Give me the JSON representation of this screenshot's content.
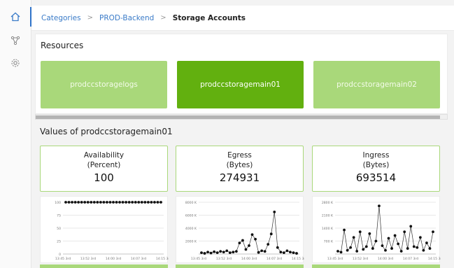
{
  "breadcrumb": {
    "items": [
      "Categories",
      "PROD-Backend"
    ],
    "current": "Storage Accounts"
  },
  "icons": {
    "home": "home-icon",
    "nodes": "network-nodes-icon",
    "settings": "gear-icon"
  },
  "colors": {
    "accent": "#2f73c9",
    "card_light": "#a9d87a",
    "card_active": "#62b00f"
  },
  "resources": {
    "title": "Resources",
    "cards": [
      "prodccstoragelogs",
      "prodccstoragemain01",
      "prodccstoragemain02"
    ],
    "selected": "prodccstoragemain01"
  },
  "values": {
    "title": "Values of prodccstoragemain01",
    "metrics": [
      {
        "name": "Availability",
        "unit": "(Percent)",
        "value": "100"
      },
      {
        "name": "Egress",
        "unit": "(Bytes)",
        "value": "274931"
      },
      {
        "name": "Ingress",
        "unit": "(Bytes)",
        "value": "693514"
      }
    ]
  },
  "chart_data": [
    {
      "type": "line",
      "x_tick_labels": [
        "13:45 3rd",
        "13:52 3rd",
        "14:00 3rd",
        "14:07 3rd",
        "14:15 3rd"
      ],
      "y_tick_labels": [
        "0",
        "25",
        "50",
        "75",
        "100"
      ],
      "ylim": [
        0,
        100
      ],
      "values": [
        100,
        100,
        100,
        100,
        100,
        100,
        100,
        100,
        100,
        100,
        100,
        100,
        100,
        100,
        100,
        100,
        100,
        100,
        100,
        100,
        100,
        100,
        100,
        100,
        100,
        100,
        100,
        100,
        100,
        100,
        100
      ],
      "grid": true
    },
    {
      "type": "line",
      "x_tick_labels": [
        "13:45 3rd",
        "13:52 3rd",
        "14:00 3rd",
        "14:07 3rd",
        "14:15 3rd"
      ],
      "y_tick_labels": [
        "",
        "2000 K",
        "4000 K",
        "6000 K",
        "8000 K"
      ],
      "ylim": [
        0,
        8000
      ],
      "values": [
        200,
        100,
        300,
        150,
        350,
        200,
        400,
        300,
        500,
        200,
        300,
        400,
        1700,
        2100,
        700,
        1300,
        3000,
        2300,
        250,
        500,
        400,
        1500,
        3100,
        6500,
        1000,
        300,
        200,
        500,
        300,
        200,
        100
      ],
      "grid": true
    },
    {
      "type": "line",
      "x_tick_labels": [
        "13:45 3rd",
        "13:52 3rd",
        "14:00 3rd",
        "14:07 3rd",
        "14:15 3rd"
      ],
      "y_tick_labels": [
        "",
        "700 K",
        "1400 K",
        "2100 K",
        "2800 K"
      ],
      "ylim": [
        0,
        2800
      ],
      "values": [
        150,
        100,
        1300,
        200,
        350,
        900,
        150,
        1200,
        250,
        400,
        1100,
        300,
        700,
        2600,
        450,
        200,
        850,
        300,
        1000,
        550,
        150,
        1200,
        300,
        1500,
        400,
        350,
        900,
        200,
        600,
        300,
        1200
      ],
      "grid": true
    }
  ]
}
